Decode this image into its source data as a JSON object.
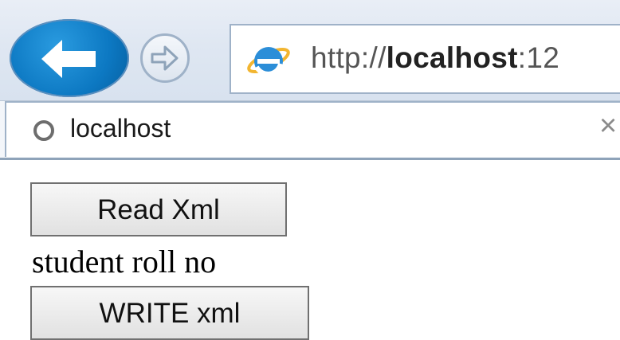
{
  "browser": {
    "address_prefix": "http://",
    "address_host": "localhost",
    "address_suffix": ":12",
    "tab_title": "localhost",
    "tab_close": "×",
    "back_icon": "back-arrow-icon",
    "forward_icon": "forward-arrow-icon",
    "browser_logo": "internet-explorer-icon",
    "tab_icon": "loading-circle-icon"
  },
  "page": {
    "read_button_label": "Read Xml",
    "student_label": "student roll no",
    "write_button_label": "WRITE xml"
  },
  "colors": {
    "back_button": "#0c78c2",
    "chrome_background": "#dfe7f2",
    "border": "#9fb2c8"
  }
}
